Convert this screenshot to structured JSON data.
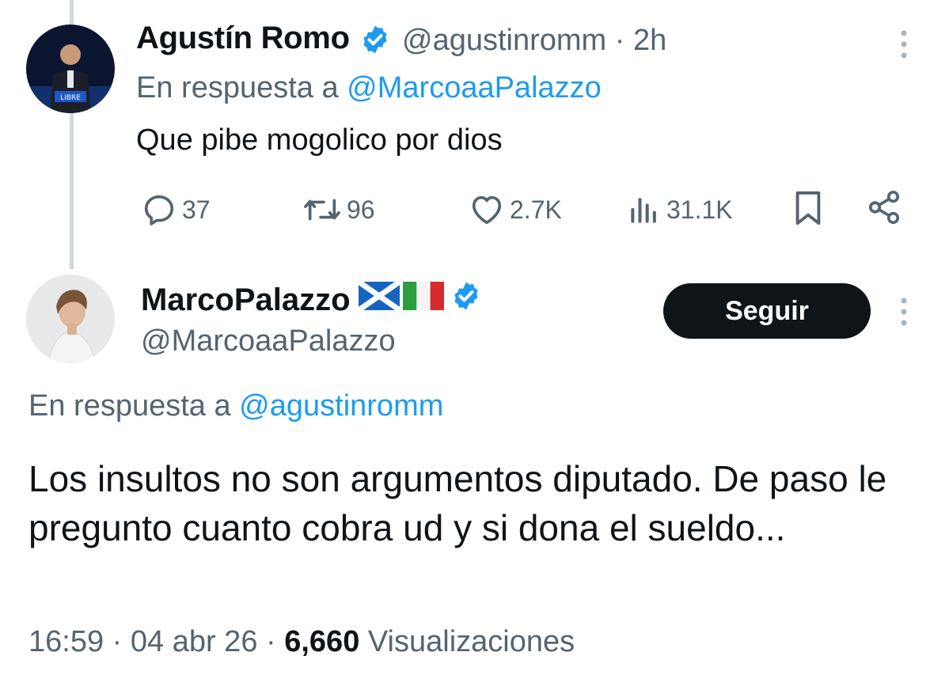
{
  "parent_tweet": {
    "author_name": "Agustín Romo",
    "handle": "@agustinromm",
    "time_sep": "·",
    "time": "2h",
    "reply_prefix": "En respuesta a",
    "reply_to": "@MarcoaaPalazzo",
    "text": "Que pibe mogolico por dios",
    "actions": {
      "replies": "37",
      "retweets": "96",
      "likes": "2.7K",
      "views": "31.1K"
    }
  },
  "main_tweet": {
    "author_name": "MarcoPalazzo",
    "handle": "@MarcoaaPalazzo",
    "follow_label": "Seguir",
    "reply_prefix": "En respuesta a",
    "reply_to": "@agustinromm",
    "text": "Los insultos no son argumentos diputado. De paso le pregunto cuanto cobra ud y si dona el sueldo...",
    "time": "16:59",
    "date": "04 abr 26",
    "views_count": "6,660",
    "views_label": "Visualizaciones"
  },
  "colors": {
    "accent": "#1d9bf0",
    "secondary_text": "#536471",
    "primary_text": "#0f1419",
    "thread_line": "#cfd9de"
  },
  "icons": [
    "verified-badge-icon",
    "more-options-icon",
    "reply-icon",
    "retweet-icon",
    "like-icon",
    "views-icon",
    "bookmark-icon",
    "share-icon",
    "scotland-flag-icon",
    "italy-flag-icon"
  ]
}
